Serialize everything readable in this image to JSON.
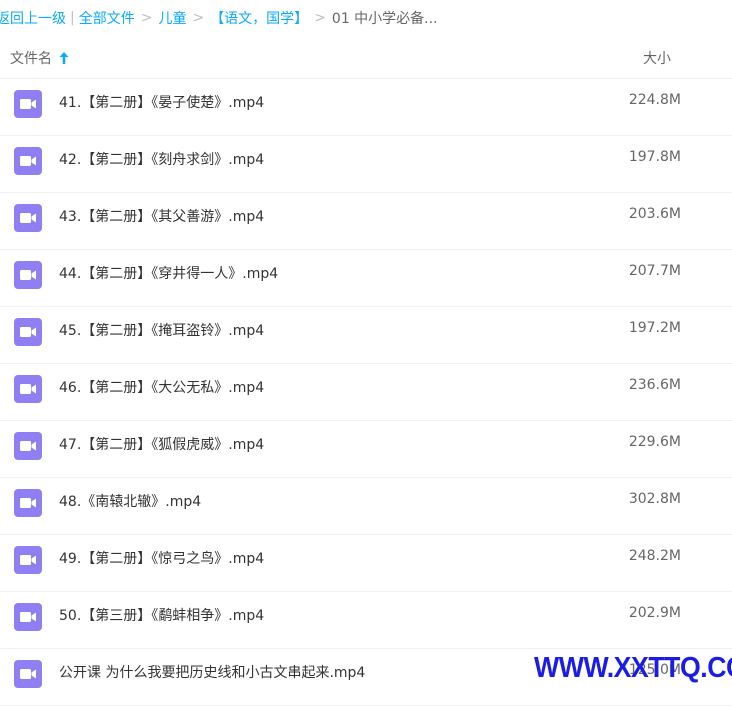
{
  "breadcrumb": {
    "back": "返回上一级",
    "all_files": "全部文件",
    "child": "儿童",
    "category": "【语文，国学】",
    "current": "01 中小学必备..."
  },
  "header": {
    "name_label": "文件名",
    "size_label": "大小"
  },
  "colors": {
    "link": "#09aaff",
    "video_icon": "#8f7ff2",
    "watermark": "#1b1de6"
  },
  "files": [
    {
      "name": "41.【第二册】《晏子使楚》.mp4",
      "size": "224.8M",
      "icon": "video-file-icon"
    },
    {
      "name": "42.【第二册】《刻舟求剑》.mp4",
      "size": "197.8M",
      "icon": "video-file-icon"
    },
    {
      "name": "43.【第二册】《其父善游》.mp4",
      "size": "203.6M",
      "icon": "video-file-icon"
    },
    {
      "name": "44.【第二册】《穿井得一人》.mp4",
      "size": "207.7M",
      "icon": "video-file-icon"
    },
    {
      "name": "45.【第二册】《掩耳盗铃》.mp4",
      "size": "197.2M",
      "icon": "video-file-icon"
    },
    {
      "name": "46.【第二册】《大公无私》.mp4",
      "size": "236.6M",
      "icon": "video-file-icon"
    },
    {
      "name": "47.【第二册】《狐假虎威》.mp4",
      "size": "229.6M",
      "icon": "video-file-icon"
    },
    {
      "name": "48.《南辕北辙》.mp4",
      "size": "302.8M",
      "icon": "video-file-icon"
    },
    {
      "name": "49.【第二册】《惊弓之鸟》.mp4",
      "size": "248.2M",
      "icon": "video-file-icon"
    },
    {
      "name": "50.【第三册】《鹬蚌相争》.mp4",
      "size": "202.9M",
      "icon": "video-file-icon"
    },
    {
      "name": "公开课 为什么我要把历史线和小古文串起来.mp4",
      "size": "125.0M",
      "icon": "video-file-icon"
    }
  ],
  "watermark": "WWW.XXTTQ.COM"
}
